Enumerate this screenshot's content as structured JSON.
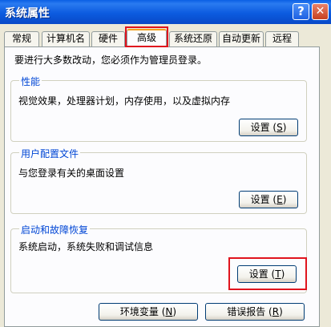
{
  "window": {
    "title": "系统属性",
    "help_glyph": "?",
    "close_glyph": "✕"
  },
  "tabs": [
    {
      "label": "常规"
    },
    {
      "label": "计算机名"
    },
    {
      "label": "硬件"
    },
    {
      "label": "高级",
      "active": true
    },
    {
      "label": "系统还原"
    },
    {
      "label": "自动更新"
    },
    {
      "label": "远程"
    }
  ],
  "intro_text": "要进行大多数改动，您必须作为管理员登录。",
  "groups": {
    "performance": {
      "label": "性能",
      "description": "视觉效果，处理器计划，内存使用，以及虚拟内存",
      "button_label": "设置",
      "button_key": "S"
    },
    "user_profiles": {
      "label": "用户配置文件",
      "description": "与您登录有关的桌面设置",
      "button_label": "设置",
      "button_key": "E"
    },
    "startup_recovery": {
      "label": "启动和故障恢复",
      "description": "系统启动，系统失败和调试信息",
      "button_label": "设置",
      "button_key": "T"
    }
  },
  "bottom_buttons": {
    "env_vars_label": "环境变量",
    "env_vars_key": "N",
    "error_report_label": "错误报告",
    "error_report_key": "R"
  },
  "colors": {
    "titlebar": "#0A5FE5",
    "group_label": "#0046D5",
    "highlight": "#E0141E"
  }
}
